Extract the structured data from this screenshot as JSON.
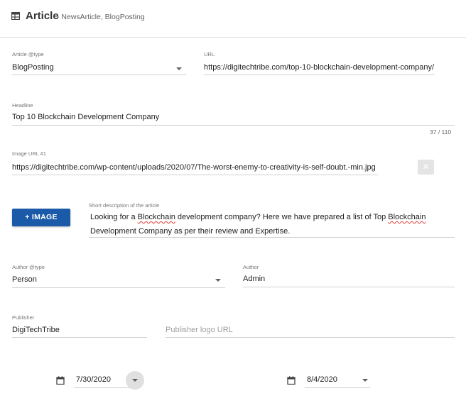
{
  "header": {
    "title": "Article",
    "subtitle": "- NewsArticle, BlogPosting"
  },
  "article_type": {
    "label": "Article @type",
    "value": "BlogPosting"
  },
  "url": {
    "label": "URL",
    "value": "https://digitechtribe.com/top-10-blockchain-development-company/"
  },
  "headline": {
    "label": "Headline",
    "value": "Top 10 Blockchain Development Company",
    "counter": "37 / 110"
  },
  "image": {
    "label": "Image URL #1",
    "value": "https://digitechtribe.com/wp-content/uploads/2020/07/The-worst-enemy-to-creativity-is-self-doubt.-min.jpg",
    "clear_symbol": "✕",
    "add_button": "+ IMAGE"
  },
  "description": {
    "label": "Short description of the article",
    "part1": "Looking for a ",
    "word1": "Blockchain",
    "part2": " development company? Here we have prepared a list of Top ",
    "word2": "Blockchain",
    "part3": " Development Company as per their review and Expertise."
  },
  "author_type": {
    "label": "Author @type",
    "value": "Person"
  },
  "author": {
    "label": "Author",
    "value": "Admin"
  },
  "publisher": {
    "label": "Publisher",
    "value": "DigiTechTribe"
  },
  "publisher_logo": {
    "placeholder": "Publisher logo URL"
  },
  "date_published": {
    "value": "7/30/2020"
  },
  "date_modified": {
    "value": "8/4/2020"
  }
}
